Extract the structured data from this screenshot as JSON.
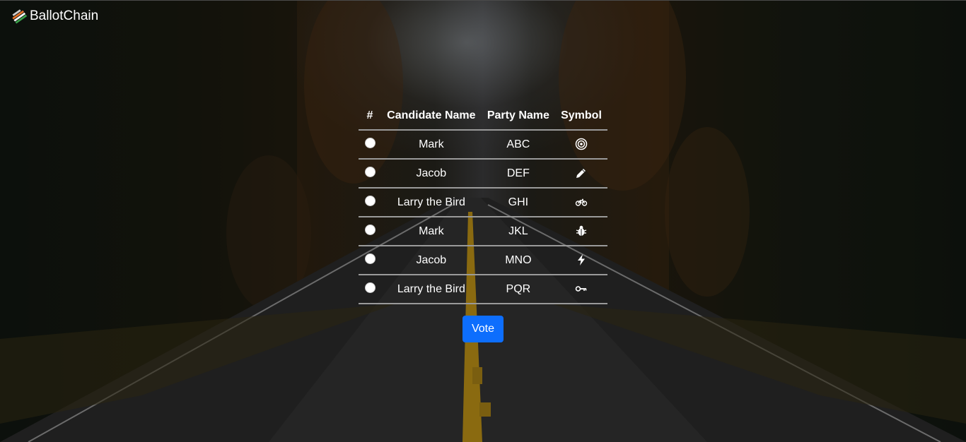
{
  "navbar": {
    "brand": "BallotChain",
    "brand_icon": "ballot-box-icon"
  },
  "table": {
    "headers": {
      "num": "#",
      "candidate": "Candidate Name",
      "party": "Party Name",
      "symbol": "Symbol"
    },
    "rows": [
      {
        "candidate": "Mark",
        "party": "ABC",
        "symbol": "bullseye-icon"
      },
      {
        "candidate": "Jacob",
        "party": "DEF",
        "symbol": "pencil-icon"
      },
      {
        "candidate": "Larry the Bird",
        "party": "GHI",
        "symbol": "bicycle-icon"
      },
      {
        "candidate": "Mark",
        "party": "JKL",
        "symbol": "bug-icon"
      },
      {
        "candidate": "Jacob",
        "party": "MNO",
        "symbol": "lightning-icon"
      },
      {
        "candidate": "Larry the Bird",
        "party": "PQR",
        "symbol": "key-icon"
      }
    ]
  },
  "vote_button": {
    "label": "Vote"
  },
  "colors": {
    "accent": "#0d6efd",
    "text": "#ffffff"
  }
}
